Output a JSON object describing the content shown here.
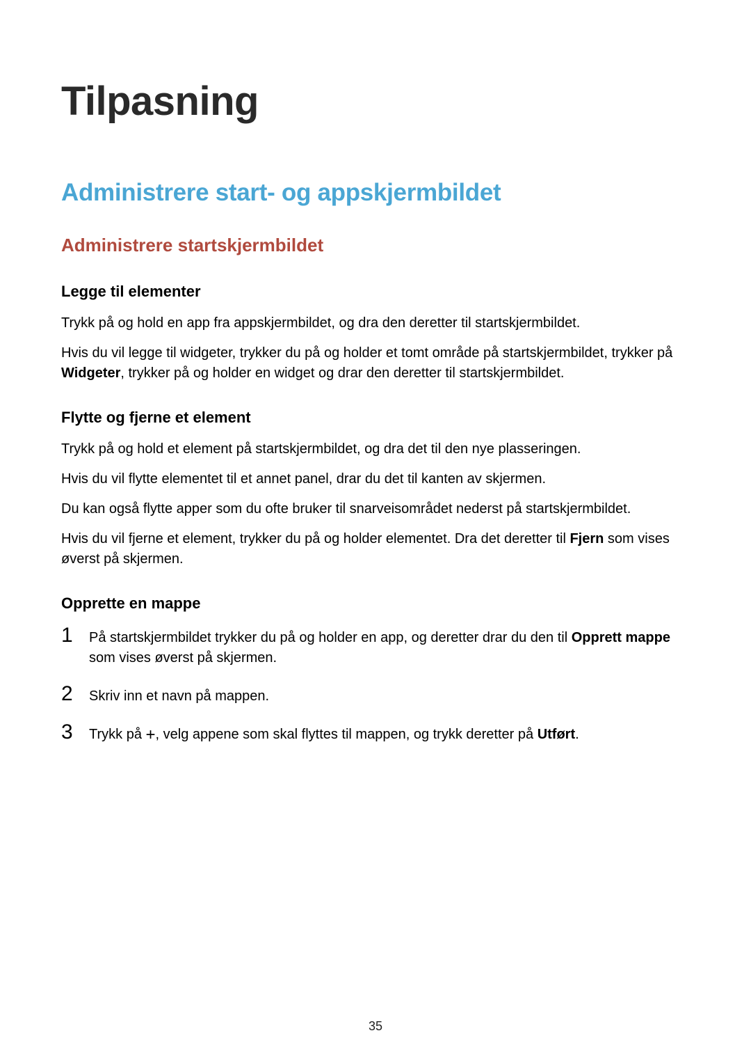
{
  "page": {
    "title": "Tilpasning",
    "h2": "Administrere start- og appskjermbildet",
    "h3": "Administrere startskjermbildet",
    "page_number": "35"
  },
  "sections": {
    "add": {
      "heading": "Legge til elementer",
      "p1": "Trykk på og hold en app fra appskjermbildet, og dra den deretter til startskjermbildet.",
      "p2a": "Hvis du vil legge til widgeter, trykker du på og holder et tomt område på startskjermbildet, trykker på ",
      "p2_bold": "Widgeter",
      "p2b": ", trykker på og holder en widget og drar den deretter til startskjermbildet."
    },
    "move": {
      "heading": "Flytte og fjerne et element",
      "p1": "Trykk på og hold et element på startskjermbildet, og dra det til den nye plasseringen.",
      "p2": "Hvis du vil flytte elementet til et annet panel, drar du det til kanten av skjermen.",
      "p3": "Du kan også flytte apper som du ofte bruker til snarveisområdet nederst på startskjermbildet.",
      "p4a": "Hvis du vil fjerne et element, trykker du på og holder elementet. Dra det deretter til ",
      "p4_bold": "Fjern",
      "p4b": " som vises øverst på skjermen."
    },
    "folder": {
      "heading": "Opprette en mappe",
      "items": [
        {
          "n": "1",
          "a": "På startskjermbildet trykker du på og holder en app, og deretter drar du den til ",
          "bold": "Opprett mappe",
          "b": " som vises øverst på skjermen."
        },
        {
          "n": "2",
          "a": "Skriv inn et navn på mappen."
        },
        {
          "n": "3",
          "a": "Trykk på ",
          "icon": "plus",
          "b": ", velg appene som skal flyttes til mappen, og trykk deretter på ",
          "bold2": "Utført",
          "c": "."
        }
      ]
    }
  }
}
